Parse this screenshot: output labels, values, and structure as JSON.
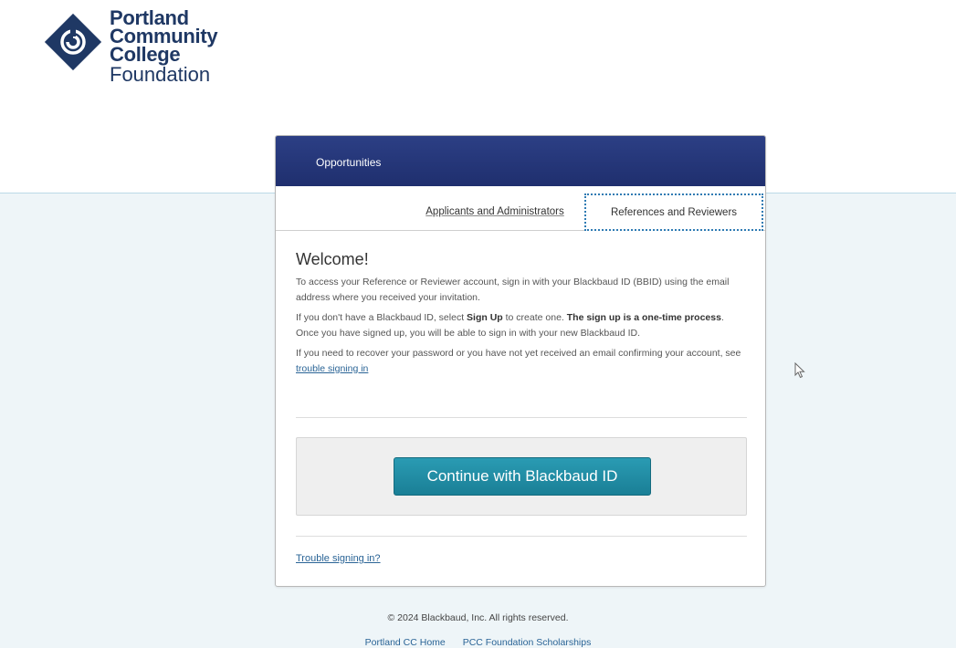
{
  "logo": {
    "line1": "Portland",
    "line2": "Community",
    "line3": "College",
    "line4": "Foundation"
  },
  "card": {
    "header_title": "Opportunities",
    "tabs": [
      {
        "label": "Applicants and Administrators",
        "active": false
      },
      {
        "label": "References and Reviewers",
        "active": true
      }
    ],
    "welcome": "Welcome!",
    "para1": "To access your Reference or Reviewer account, sign in with your Blackbaud ID (BBID) using the email address where you received your invitation.",
    "para2_pre": "If you don't have a Blackbaud ID, select ",
    "para2_signup": "Sign Up",
    "para2_mid": " to create one. ",
    "para2_bold": "The sign up is a one-time process",
    "para2_post": ". Once you have signed up, you will be able to sign in with your new Blackbaud ID.",
    "para3_pre": "If you need to recover your password or you have not yet received an email confirming your account, see ",
    "para3_link": "trouble signing in",
    "continue_button": "Continue with Blackbaud ID",
    "trouble_link": "Trouble signing in?"
  },
  "footer": {
    "copyright": "© 2024 Blackbaud, Inc. All rights reserved.",
    "links": [
      "Portland CC Home",
      "PCC Foundation Scholarships"
    ]
  },
  "colors": {
    "brand_navy": "#1f3864",
    "header_blue": "#2c3f85",
    "button_teal": "#1a8aa3",
    "link_blue": "#2a6496"
  },
  "icons": {
    "logo_mark": "pcc-spiral-diamond-icon",
    "cursor": "mouse-pointer-icon"
  }
}
